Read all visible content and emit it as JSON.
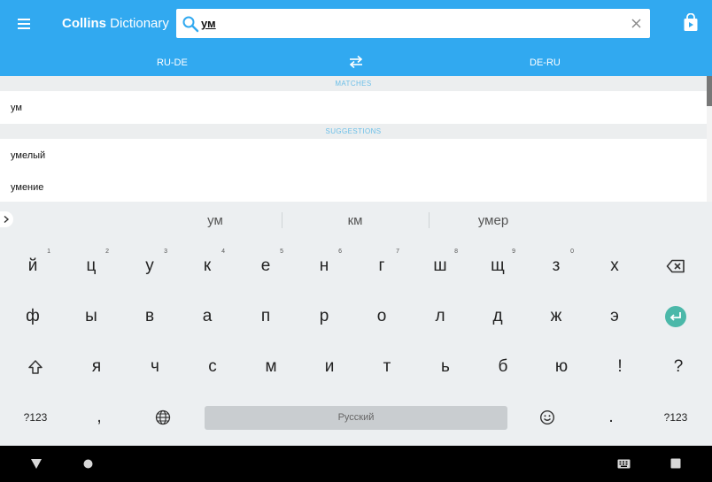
{
  "app": {
    "brand_bold": "Collins",
    "brand_rest": " Dictionary",
    "search": {
      "value": "ум",
      "placeholder": ""
    },
    "direction": {
      "left": "RU-DE",
      "right": "DE-RU"
    }
  },
  "results": {
    "matches_header": "MATCHES",
    "matches": [
      "ум"
    ],
    "suggestions_header": "SUGGESTIONS",
    "suggestions": [
      "умелый",
      "умение"
    ]
  },
  "keyboard": {
    "suggestions": [
      "ум",
      "км",
      "умер"
    ],
    "row1": [
      {
        "label": "й",
        "hint": "1"
      },
      {
        "label": "ц",
        "hint": "2"
      },
      {
        "label": "у",
        "hint": "3"
      },
      {
        "label": "к",
        "hint": "4"
      },
      {
        "label": "е",
        "hint": "5"
      },
      {
        "label": "н",
        "hint": "6"
      },
      {
        "label": "г",
        "hint": "7"
      },
      {
        "label": "ш",
        "hint": "8"
      },
      {
        "label": "щ",
        "hint": "9"
      },
      {
        "label": "з",
        "hint": "0"
      },
      {
        "label": "х",
        "hint": ""
      }
    ],
    "row2": [
      "ф",
      "ы",
      "в",
      "а",
      "п",
      "р",
      "о",
      "л",
      "д",
      "ж",
      "э"
    ],
    "row3": [
      "я",
      "ч",
      "с",
      "м",
      "и",
      "т",
      "ь",
      "б",
      "ю",
      "!",
      "?"
    ],
    "row4": {
      "symbols_left": "?123",
      "comma": ",",
      "space": "Русский",
      "period": ".",
      "symbols_right": "?123"
    }
  },
  "colors": {
    "appbar": "#31a9f0",
    "accent_teal": "#4bb8a9",
    "section_header_text": "#6bbfe8",
    "keyboard_bg": "#eceff1"
  },
  "icons": {
    "menu": "menu-icon",
    "search": "search-icon",
    "clear": "close-icon",
    "store": "shopping-bag-icon",
    "swap": "swap-arrows-icon",
    "backspace": "backspace-icon",
    "enter": "enter-icon",
    "shift": "shift-icon",
    "globe": "globe-icon",
    "emoji": "emoji-icon",
    "expand": "chevron-right-icon",
    "back": "back-triangle-icon",
    "home": "home-circle-icon",
    "keyboard_switch": "keyboard-icon",
    "recents": "recents-square-icon"
  }
}
